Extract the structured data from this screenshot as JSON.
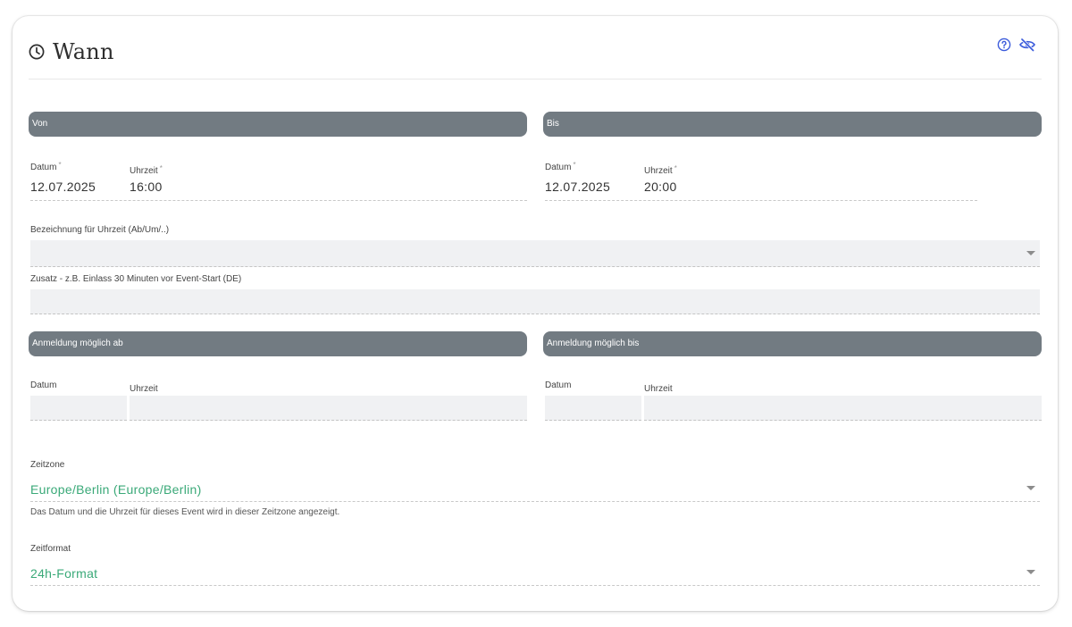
{
  "card": {
    "title": "Wann",
    "icons": {
      "title": "clock-icon",
      "help": "help-circle-icon",
      "visibility": "eye-off-icon"
    }
  },
  "von": {
    "header": "Von",
    "date_label": "Datum",
    "time_label": "Uhrzeit",
    "required_mark": "*",
    "date_value": "12.07.2025",
    "time_value": "16:00"
  },
  "bis": {
    "header": "Bis",
    "date_label": "Datum",
    "time_label": "Uhrzeit",
    "required_mark": "*",
    "date_value": "12.07.2025",
    "time_value": "20:00"
  },
  "bezeichnung": {
    "label": "Bezeichnung für Uhrzeit (Ab/Um/..)",
    "value": ""
  },
  "zusatz": {
    "label": "Zusatz - z.B. Einlass 30 Minuten vor Event-Start (DE)",
    "value": ""
  },
  "anmeldung_ab": {
    "header": "Anmeldung möglich ab",
    "date_label": "Datum",
    "time_label": "Uhrzeit",
    "date_value": "",
    "time_value": ""
  },
  "anmeldung_bis": {
    "header": "Anmeldung möglich bis",
    "date_label": "Datum",
    "time_label": "Uhrzeit",
    "date_value": "",
    "time_value": ""
  },
  "zeitzone": {
    "label": "Zeitzone",
    "value": "Europe/Berlin (Europe/Berlin)",
    "hint": "Das Datum und die Uhrzeit für dieses Event wird in dieser Zeitzone angezeigt."
  },
  "zeitformat": {
    "label": "Zeitformat",
    "value": "24h-Format"
  },
  "colors": {
    "section_header": "#727b82",
    "accent_green": "#3aa978",
    "icon_blue": "#3b5bdb"
  }
}
